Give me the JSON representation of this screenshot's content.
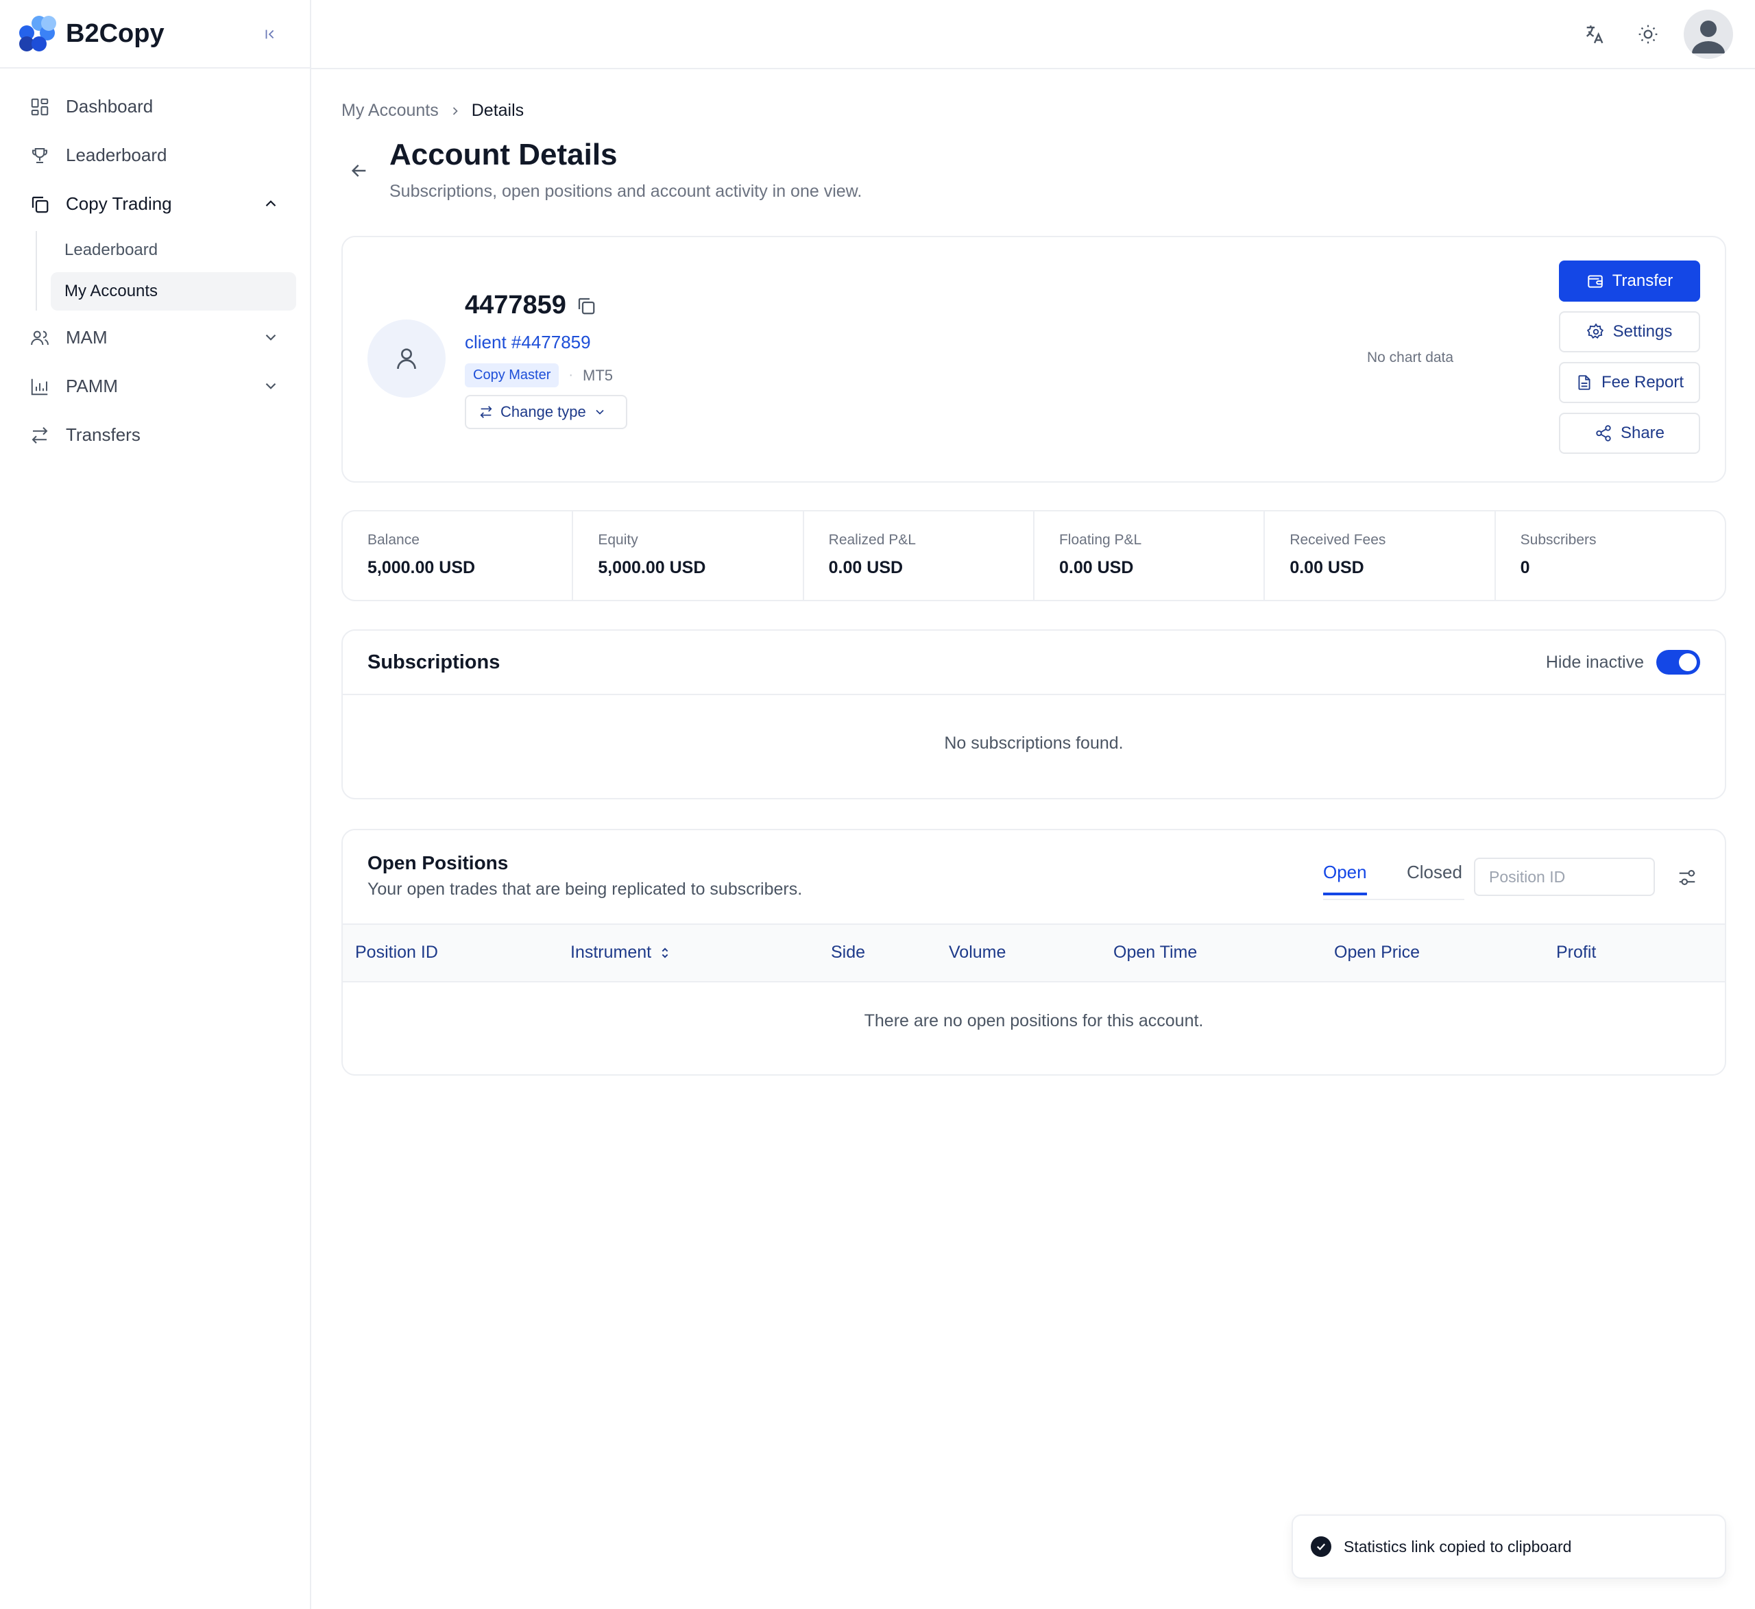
{
  "brand": {
    "name": "B2Copy",
    "colors": {
      "primary": "#1447e6",
      "link": "#1d4ed8",
      "dark_blue": "#1e3a8a"
    }
  },
  "sidebar": {
    "items": [
      {
        "label": "Dashboard",
        "icon": "dashboard-icon"
      },
      {
        "label": "Leaderboard",
        "icon": "trophy-icon"
      },
      {
        "label": "Copy Trading",
        "icon": "copy-icon",
        "expanded": true,
        "children": [
          {
            "label": "Leaderboard"
          },
          {
            "label": "My Accounts",
            "active": true
          }
        ]
      },
      {
        "label": "MAM",
        "icon": "users-icon",
        "expanded": false
      },
      {
        "label": "PAMM",
        "icon": "bar-chart-icon",
        "expanded": false
      },
      {
        "label": "Transfers",
        "icon": "arrows-icon"
      }
    ]
  },
  "topbar": {
    "icons": [
      "translate-icon",
      "sun-icon",
      "user-avatar-icon"
    ]
  },
  "breadcrumb": {
    "parent": "My Accounts",
    "current": "Details"
  },
  "page": {
    "title": "Account Details",
    "subtitle": "Subscriptions, open positions and account activity in one view."
  },
  "account": {
    "id": "4477859",
    "client": "client #4477859",
    "badge": "Copy Master",
    "platform": "MT5",
    "change_type_label": "Change type",
    "no_chart": "No chart data",
    "actions": {
      "transfer": "Transfer",
      "settings": "Settings",
      "fee_report": "Fee Report",
      "share": "Share"
    }
  },
  "stats": [
    {
      "label": "Balance",
      "value": "5,000.00 USD"
    },
    {
      "label": "Equity",
      "value": "5,000.00 USD"
    },
    {
      "label": "Realized P&L",
      "value": "0.00 USD"
    },
    {
      "label": "Floating P&L",
      "value": "0.00 USD"
    },
    {
      "label": "Received Fees",
      "value": "0.00 USD"
    },
    {
      "label": "Subscribers",
      "value": "0"
    }
  ],
  "subscriptions": {
    "title": "Subscriptions",
    "hide_inactive_label": "Hide inactive",
    "hide_inactive_on": true,
    "empty": "No subscriptions found."
  },
  "positions": {
    "title": "Open Positions",
    "subtitle": "Your open trades that are being replicated to subscribers.",
    "tabs": [
      {
        "label": "Open",
        "active": true
      },
      {
        "label": "Closed"
      }
    ],
    "search_placeholder": "Position ID",
    "columns": [
      "Position ID",
      "Instrument",
      "Side",
      "Volume",
      "Open Time",
      "Open Price",
      "Profit"
    ],
    "empty": "There are no open positions for this account."
  },
  "toast": {
    "message": "Statistics link copied to clipboard"
  }
}
